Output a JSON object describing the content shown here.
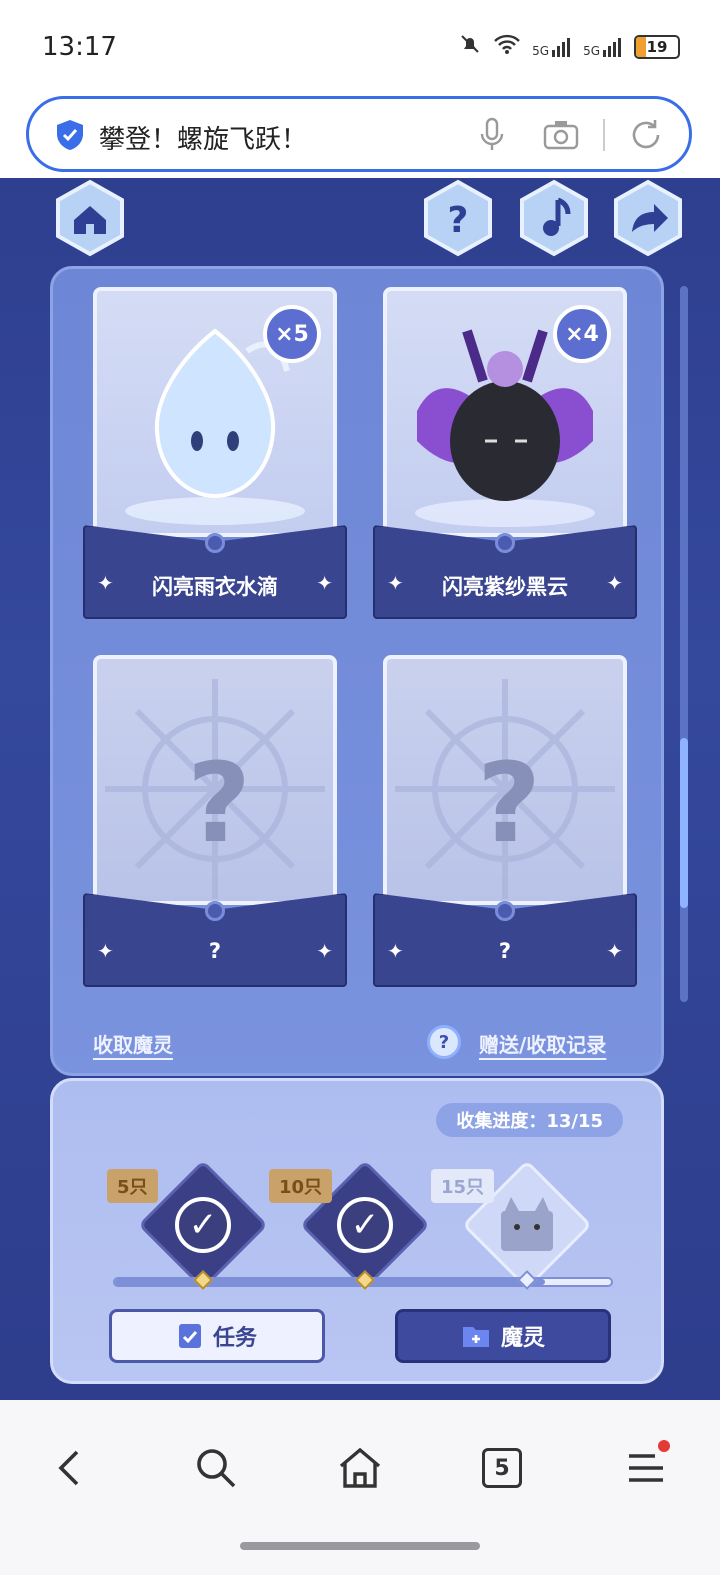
{
  "status_bar": {
    "time": "13:17",
    "signal_labels": [
      "5G",
      "5G"
    ],
    "battery": "19"
  },
  "address_bar": {
    "title": "攀登！螺旋飞跃！"
  },
  "game": {
    "top_buttons": [
      "home-icon",
      "help-icon",
      "music-icon",
      "share-icon"
    ],
    "cards": [
      {
        "name": "闪亮雨衣水滴",
        "count": "×5",
        "revealed": true
      },
      {
        "name": "闪亮紫纱黑云",
        "count": "×4",
        "revealed": true
      },
      {
        "name": "?",
        "count": "",
        "revealed": false
      },
      {
        "name": "?",
        "count": "",
        "revealed": false
      }
    ],
    "unknown_mark": "?",
    "links": {
      "collect": "收取魔灵",
      "records": "赠送/收取记录",
      "help_mark": "?"
    },
    "progress": {
      "label": "收集进度：13/15",
      "fraction": 0.8667,
      "milestones": [
        {
          "label": "5只",
          "done": true
        },
        {
          "label": "10只",
          "done": true
        },
        {
          "label": "15只",
          "done": false
        }
      ]
    },
    "buttons": {
      "task": "任务",
      "spirit": "魔灵"
    }
  },
  "bottom_nav": {
    "tabs_count": "5",
    "items": [
      "back-icon",
      "search-icon",
      "home-icon",
      "tabs-icon",
      "menu-icon"
    ]
  },
  "colors": {
    "accent": "#3a6de8",
    "game_bg": "#2f3f8f",
    "panel": "#7a93de"
  }
}
